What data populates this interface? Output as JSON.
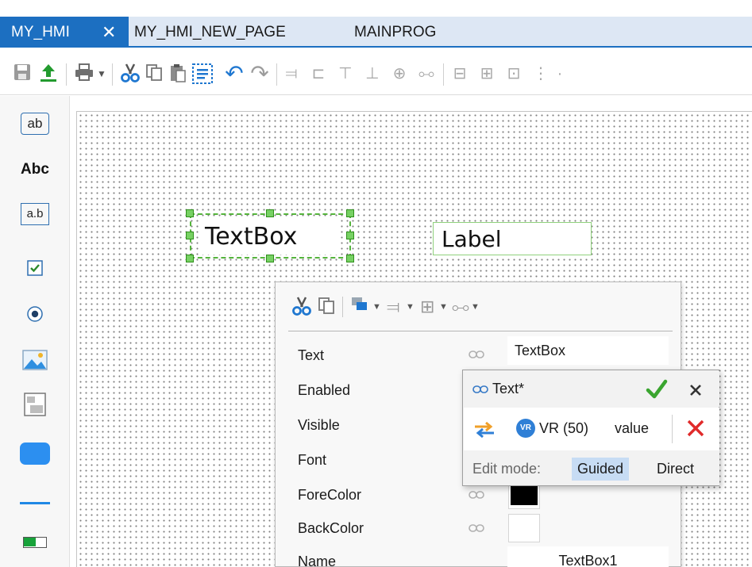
{
  "tabs": [
    {
      "label": "MY_HMI",
      "active": true,
      "close": "✕"
    },
    {
      "label": "MY_HMI_NEW_PAGE",
      "active": false
    },
    {
      "label": "MAINPROG",
      "active": false
    }
  ],
  "toolbar": {
    "icons": [
      "save-icon",
      "upload-icon",
      "print-icon",
      "dropdown-arrow-icon",
      "cut-icon",
      "copy-icon",
      "paste-icon",
      "select-all-icon",
      "undo-icon",
      "redo-icon",
      "align-left-icon",
      "align-center-icon",
      "align-top-icon",
      "align-bottom-icon",
      "center-vertical-icon",
      "center-horizontal-icon",
      "same-width-icon",
      "same-height-icon",
      "same-size-icon",
      "distribute-icon"
    ]
  },
  "toolbox": {
    "items": [
      {
        "name": "textbox-tool",
        "label": "ab"
      },
      {
        "name": "label-tool",
        "label": "Abc"
      },
      {
        "name": "input-tool",
        "label": "a.b"
      },
      {
        "name": "checkbox-tool",
        "label": ""
      },
      {
        "name": "radiobutton-tool",
        "label": ""
      },
      {
        "name": "image-tool",
        "label": ""
      },
      {
        "name": "panel-tool",
        "label": ""
      },
      {
        "name": "button-tool",
        "label": ""
      },
      {
        "name": "line-tool",
        "label": ""
      },
      {
        "name": "progressbar-tool",
        "label": ""
      }
    ]
  },
  "canvas": {
    "textbox": {
      "text": "TextBox",
      "selected": true
    },
    "label": {
      "text": "Label"
    }
  },
  "properties": {
    "rows": [
      {
        "label": "Text",
        "value": "TextBox"
      },
      {
        "label": "Enabled",
        "value": ""
      },
      {
        "label": "Visible",
        "value": ""
      },
      {
        "label": "Font",
        "value": ""
      },
      {
        "label": "ForeColor",
        "value": "",
        "color": "#000000"
      },
      {
        "label": "BackColor",
        "value": "",
        "color": "#ffffff"
      },
      {
        "label": "Name",
        "value": "TextBox1"
      }
    ]
  },
  "binding_popup": {
    "title": "Text*",
    "source_badge": "VR",
    "variable": "VR (50)",
    "field": "value",
    "edit_mode_label": "Edit mode:",
    "modes": [
      "Guided",
      "Direct"
    ],
    "active_mode": "Guided"
  },
  "colors": {
    "accent": "#1c6fc1",
    "selection": "#55b43c",
    "confirm": "#3aa52f",
    "delete": "#e02a2a",
    "guided_highlight": "#c7dcf4"
  }
}
